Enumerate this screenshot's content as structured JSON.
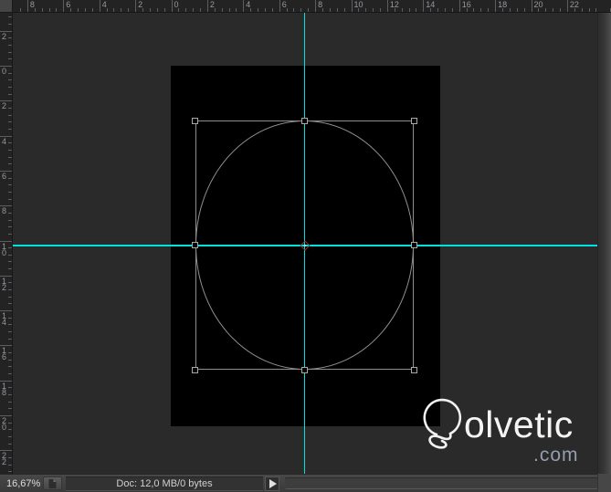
{
  "rulers": {
    "top": {
      "labels": [
        "8",
        "6",
        "4",
        "2",
        "0",
        "2",
        "4",
        "6",
        "8",
        "10",
        "12",
        "14",
        "16",
        "18",
        "20",
        "22"
      ]
    },
    "left": {
      "labels": [
        "2",
        "0",
        "2",
        "4",
        "6",
        "8",
        "10",
        "12",
        "14",
        "16",
        "18",
        "20",
        "22"
      ]
    }
  },
  "status_bar": {
    "zoom_level": "16,67%",
    "doc_info": "Doc: 12,0 MB/0 bytes"
  },
  "logo": {
    "text": "olvetic",
    "tld": ".com"
  },
  "colors": {
    "guide": "#00e1e1",
    "selection_stroke": "#8f8f8f",
    "workspace": "#2a2a2a",
    "canvas": "#000000",
    "reference_point": "#8a3a32"
  }
}
